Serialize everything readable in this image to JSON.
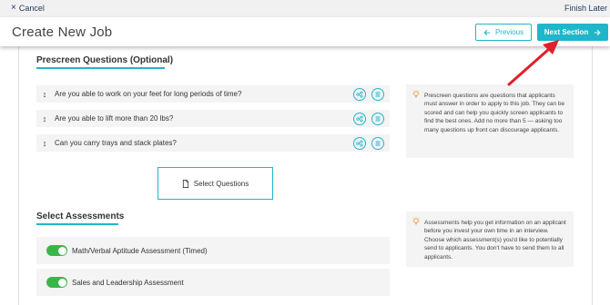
{
  "topbar": {
    "cancel_label": "Cancel",
    "finish_label": "Finish Later"
  },
  "header": {
    "title": "Create New Job",
    "previous_label": "Previous",
    "next_label": "Next Section"
  },
  "prescreen": {
    "title": "Prescreen Questions (Optional)",
    "questions": [
      "Are you able to work on your feet for long periods of time?",
      "Are you able to lift more than 20 lbs?",
      "Can you carry trays and stack plates?"
    ],
    "select_label": "Select Questions",
    "info_text": "Prescreen questions are questions that applicants must answer in order to apply to this job. They can be scored and can help you quickly screen applicants to find the best ones. Add no more than 5 — asking too many questions up front can discourage applicants."
  },
  "assessments": {
    "title": "Select Assessments",
    "items": [
      {
        "label": "Math/Verbal Aptitude Assessment (Timed)",
        "enabled": true
      },
      {
        "label": "Sales and Leadership Assessment",
        "enabled": true
      }
    ],
    "info_text": "Assessments help you get information on an applicant before you invest your own time in an interview. Choose which assessment(s) you'd like to potentially send to applicants. You don't have to send them to all applicants."
  },
  "colors": {
    "accent": "#1fb6c9",
    "toggle_on": "#3bb54a",
    "annotation_arrow": "#e0202a",
    "bulb": "#f0932b"
  },
  "icons": {
    "cancel": "close-icon",
    "previous": "arrow-left-icon",
    "next": "arrow-right-icon",
    "grip": "drag-handle-icon",
    "scoring": "scoring-icon",
    "list": "list-icon",
    "document": "document-icon",
    "tip": "lightbulb-icon"
  }
}
